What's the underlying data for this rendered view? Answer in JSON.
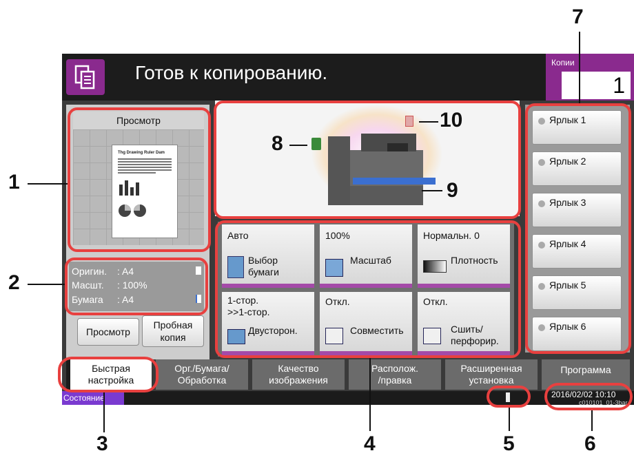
{
  "header": {
    "title": "Готов к копированию.",
    "copies_label": "Копии",
    "copies_value": "1"
  },
  "preview": {
    "title": "Просмотр",
    "doc_heading": "Thg Drawing Ruler Dam"
  },
  "info": {
    "original_label": "Оригин.",
    "original_val": ": A4",
    "scale_label": "Масшт.",
    "scale_val": ": 100%",
    "paper_label": "Бумага",
    "paper_val": ": A4"
  },
  "buttons": {
    "preview": "Просмотр",
    "proof_copy_line1": "Пробная",
    "proof_copy_line2": "копия"
  },
  "functions": [
    {
      "value": "Авто",
      "label_line1": "Выбор",
      "label_line2": "бумаги"
    },
    {
      "value": "100%",
      "label_line1": "Масштаб",
      "label_line2": ""
    },
    {
      "value": "Нормальн. 0",
      "label_line1": "Плотность",
      "label_line2": ""
    },
    {
      "value_line1": "1-стор.",
      "value_line2": ">>1-стор.",
      "label_line1": "Двусторон.",
      "label_line2": ""
    },
    {
      "value": "Откл.",
      "label_line1": "Совместить",
      "label_line2": ""
    },
    {
      "value": "Откл.",
      "label_line1": "Сшить/",
      "label_line2": "перфорир."
    }
  ],
  "shortcuts": [
    "Ярлык 1",
    "Ярлык 2",
    "Ярлык 3",
    "Ярлык 4",
    "Ярлык 5",
    "Ярлык 6"
  ],
  "tabs": [
    {
      "line1": "Быстрая",
      "line2": "настройка"
    },
    {
      "line1": "Орг./Бумага/",
      "line2": "Обработка"
    },
    {
      "line1": "Качество",
      "line2": "изображения"
    },
    {
      "line1": "Располож.",
      "line2": "/правка"
    },
    {
      "line1": "Расширенная",
      "line2": "установка"
    },
    {
      "line1": "Программа",
      "line2": ""
    }
  ],
  "status": {
    "label": "Состояние",
    "datetime": "2016/02/02  10:10",
    "code": "c010101_01-3bar"
  },
  "callouts": [
    "1",
    "2",
    "3",
    "4",
    "5",
    "6",
    "7",
    "8",
    "9",
    "10"
  ],
  "colors": {
    "accent": "#8a2a8e",
    "highlight": "#e8403f",
    "status_label": "#7a3ad0"
  }
}
